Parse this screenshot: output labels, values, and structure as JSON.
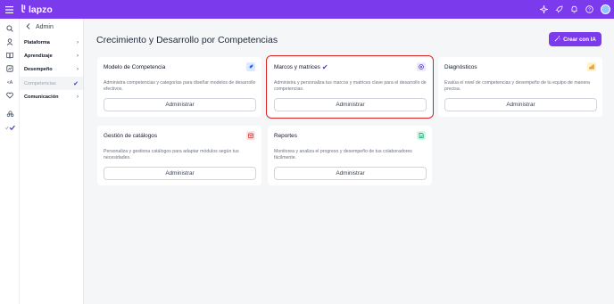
{
  "topbar": {
    "brand": "lapzo",
    "icons": [
      "menu-icon",
      "sparkle-icon",
      "rocket-icon",
      "bell-icon",
      "help-icon",
      "avatar"
    ]
  },
  "sidebar": {
    "back_label": "Admin",
    "items": [
      {
        "label": "Plataforma",
        "has_chevron": true
      },
      {
        "label": "Aprendizaje",
        "has_chevron": true
      },
      {
        "label": "Desempeño",
        "has_chevron": true
      },
      {
        "label": "Competencias",
        "active": true
      },
      {
        "label": "Comunicación",
        "has_chevron": true
      }
    ]
  },
  "page": {
    "title": "Crecimiento y Desarrollo por Competencias",
    "cta_label": "Crear con IA"
  },
  "cards": [
    {
      "title": "Modelo de Competencia",
      "description": "Administra competencias y categorías para diseñar modelos de desarrollo efectivos.",
      "button": "Administrar",
      "icon": "rocket-icon",
      "icon_color": "#2563eb"
    },
    {
      "title": "Marcos y matrices",
      "description": "Administra y personaliza tus marcos y matrices clave para el desarrollo de competencias.",
      "button": "Administrar",
      "icon": "target-icon",
      "icon_color": "#4338ca",
      "selected": true
    },
    {
      "title": "Diagnósticos",
      "description": "Evalúa el nivel de competencias y desempeño de tu equipo de manera precisa.",
      "button": "Administrar",
      "icon": "chart-icon",
      "icon_color": "#d97706"
    },
    {
      "title": "Gestión de catálogos",
      "description": "Personaliza y gestiona catálogos para adaptar módulos según tus necesidades.",
      "button": "Administrar",
      "icon": "catalog-icon",
      "icon_color": "#dc2626"
    },
    {
      "title": "Reportes",
      "description": "Monitorea y analiza el progreso y desempeño de tus colaboradores fácilmente.",
      "button": "Administrar",
      "icon": "report-icon",
      "icon_color": "#059669"
    }
  ],
  "colors": {
    "brand": "#7c3aed",
    "selection": "#dc2626",
    "check": "#4338ca"
  }
}
